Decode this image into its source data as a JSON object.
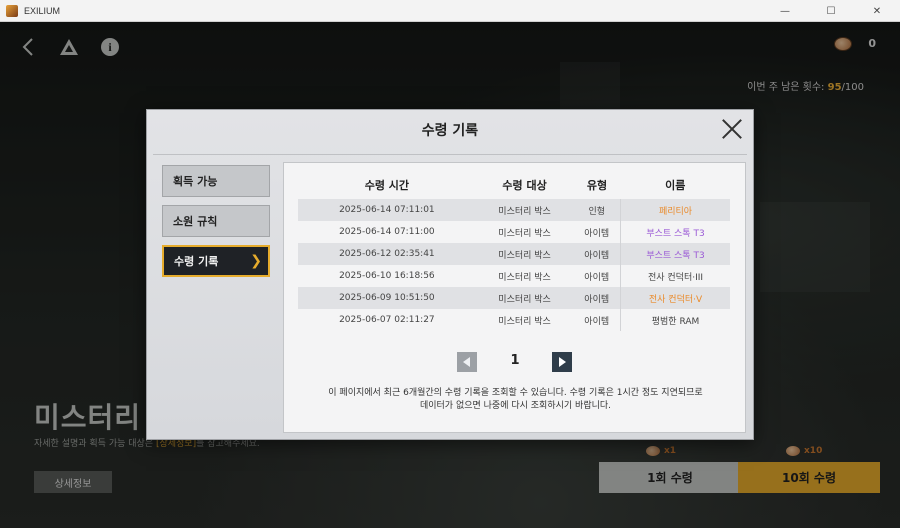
{
  "window": {
    "title": "EXILIUM",
    "minimize": "—",
    "maximize": "☐",
    "close": "✕"
  },
  "game": {
    "currency_value": "0",
    "weekly_remaining": {
      "label": "이번 주 남은 횟수: ",
      "current": "95",
      "total": "/100"
    },
    "banner_title": "미스터리",
    "description": {
      "prefix": "자세한 설명과 획득 가능 대상은 ",
      "link": "[상세정보]",
      "suffix": "를 참고해주세요."
    },
    "detail_button": "상세정보",
    "pull_1": {
      "cost": "x1",
      "label": "1회 수령"
    },
    "pull_10": {
      "cost": "x10",
      "label": "10회 수령"
    }
  },
  "modal": {
    "title": "수령 기록",
    "tabs": [
      {
        "label": "획득 가능"
      },
      {
        "label": "소원 규칙"
      },
      {
        "label": "수령 기록",
        "active": true
      }
    ],
    "table": {
      "headers": [
        "수령 시간",
        "수령 대상",
        "유형",
        "이름"
      ],
      "rows": [
        {
          "time": "2025-06-14 07:11:01",
          "target": "미스터리 박스",
          "type": "인형",
          "name": "페리티아",
          "color": "orange"
        },
        {
          "time": "2025-06-14 07:11:00",
          "target": "미스터리 박스",
          "type": "아이템",
          "name": "부스트 스톡 T3",
          "color": "purple"
        },
        {
          "time": "2025-06-12 02:35:41",
          "target": "미스터리 박스",
          "type": "아이템",
          "name": "부스트 스톡 T3",
          "color": "purple"
        },
        {
          "time": "2025-06-10 16:18:56",
          "target": "미스터리 박스",
          "type": "아이템",
          "name": "전사 컨덕터·III",
          "color": "plain"
        },
        {
          "time": "2025-06-09 10:51:50",
          "target": "미스터리 박스",
          "type": "아이템",
          "name": "전사 컨덕터·V",
          "color": "orange"
        },
        {
          "time": "2025-06-07 02:11:27",
          "target": "미스터리 박스",
          "type": "아이템",
          "name": "평범한 RAM",
          "color": "plain"
        }
      ]
    },
    "pager": {
      "page": "1"
    },
    "notice_line1": "이 페이지에서 최근 6개월간의 수령 기록을 조회할 수 있습니다. 수령 기록은 1시간 정도 지연되므로",
    "notice_line2": "데이터가 없으면 나중에 다시 조회하시기 바랍니다."
  },
  "colors": {
    "accent": "#e8ac2c",
    "orange_item": "#ea8a2a",
    "purple_item": "#9b5bd6"
  }
}
